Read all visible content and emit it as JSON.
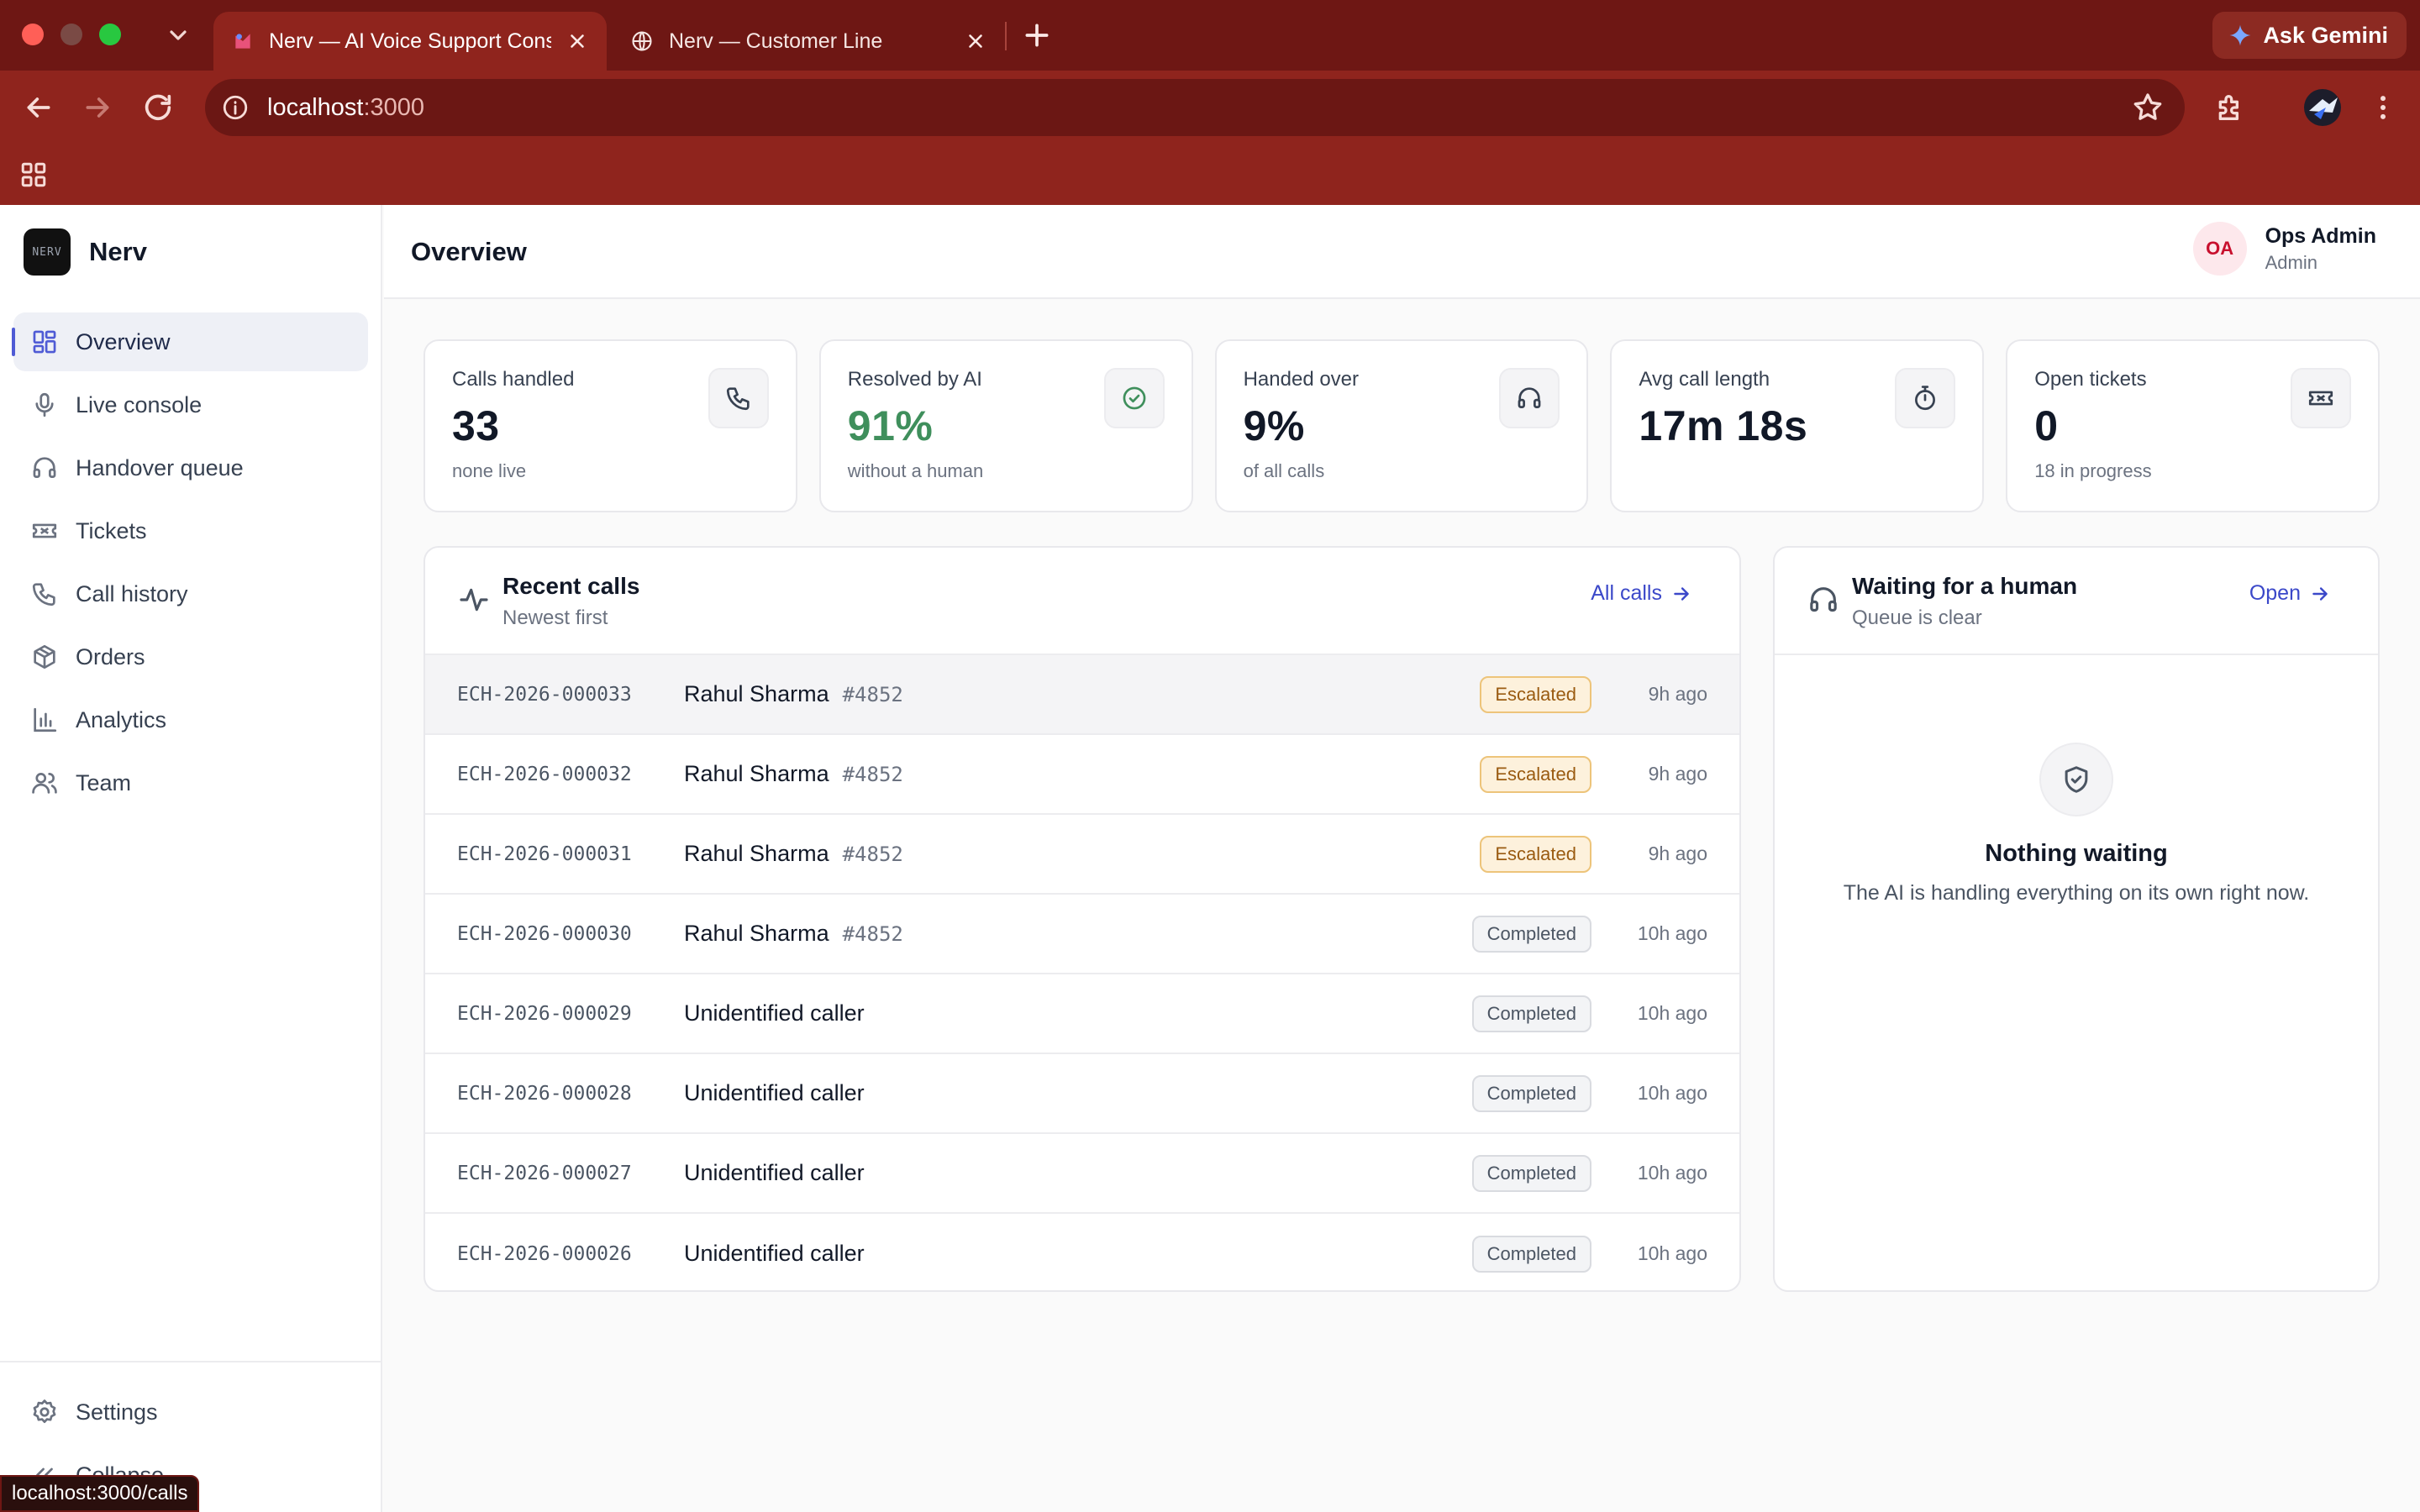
{
  "browser": {
    "tabs": [
      {
        "title": "Nerv — AI Voice Support Console",
        "active": true
      },
      {
        "title": "Nerv — Customer Line",
        "active": false
      }
    ],
    "gemini_label": "Ask Gemini",
    "url_host": "localhost",
    "url_port": ":3000",
    "status_url": "localhost:3000/calls"
  },
  "sidebar": {
    "brand": "Nerv",
    "logo_text": "NERV",
    "items": [
      {
        "label": "Overview",
        "icon": "dashboard-icon",
        "active": true
      },
      {
        "label": "Live console",
        "icon": "microphone-icon"
      },
      {
        "label": "Handover queue",
        "icon": "headset-icon"
      },
      {
        "label": "Tickets",
        "icon": "ticket-icon"
      },
      {
        "label": "Call history",
        "icon": "phone-icon"
      },
      {
        "label": "Orders",
        "icon": "package-icon"
      },
      {
        "label": "Analytics",
        "icon": "bar-chart-icon"
      },
      {
        "label": "Team",
        "icon": "users-icon"
      }
    ],
    "settings_label": "Settings",
    "collapse_label": "Collapse"
  },
  "header": {
    "title": "Overview",
    "user": {
      "initials": "OA",
      "name": "Ops Admin",
      "role": "Admin"
    }
  },
  "stats": [
    {
      "label": "Calls handled",
      "value": "33",
      "sub": "none live",
      "icon": "phone-icon"
    },
    {
      "label": "Resolved by AI",
      "value": "91%",
      "sub": "without a human",
      "icon": "check-circle-icon",
      "accent": "#3f8f5c"
    },
    {
      "label": "Handed over",
      "value": "9%",
      "sub": "of all calls",
      "icon": "headset-icon"
    },
    {
      "label": "Avg call length",
      "value": "17m 18s",
      "sub": "",
      "icon": "stopwatch-icon"
    },
    {
      "label": "Open tickets",
      "value": "0",
      "sub": "18 in progress",
      "icon": "ticket-icon"
    }
  ],
  "recent_calls": {
    "title": "Recent calls",
    "subtitle": "Newest first",
    "link_label": "All calls",
    "rows": [
      {
        "id": "ECH-2026-000033",
        "caller": "Rahul Sharma",
        "ref": "#4852",
        "status": "Escalated",
        "time": "9h ago"
      },
      {
        "id": "ECH-2026-000032",
        "caller": "Rahul Sharma",
        "ref": "#4852",
        "status": "Escalated",
        "time": "9h ago"
      },
      {
        "id": "ECH-2026-000031",
        "caller": "Rahul Sharma",
        "ref": "#4852",
        "status": "Escalated",
        "time": "9h ago"
      },
      {
        "id": "ECH-2026-000030",
        "caller": "Rahul Sharma",
        "ref": "#4852",
        "status": "Completed",
        "time": "10h ago"
      },
      {
        "id": "ECH-2026-000029",
        "caller": "Unidentified caller",
        "ref": "",
        "status": "Completed",
        "time": "10h ago"
      },
      {
        "id": "ECH-2026-000028",
        "caller": "Unidentified caller",
        "ref": "",
        "status": "Completed",
        "time": "10h ago"
      },
      {
        "id": "ECH-2026-000027",
        "caller": "Unidentified caller",
        "ref": "",
        "status": "Completed",
        "time": "10h ago"
      },
      {
        "id": "ECH-2026-000026",
        "caller": "Unidentified caller",
        "ref": "",
        "status": "Completed",
        "time": "10h ago"
      }
    ]
  },
  "waiting": {
    "title": "Waiting for a human",
    "subtitle": "Queue is clear",
    "link_label": "Open",
    "empty_title": "Nothing waiting",
    "empty_desc": "The AI is handling everything on its own right now."
  },
  "colors": {
    "chrome": "#8f241d",
    "accent": "#4f5bd5",
    "success": "#3f8f5c",
    "escalated": "#9a5b11"
  }
}
